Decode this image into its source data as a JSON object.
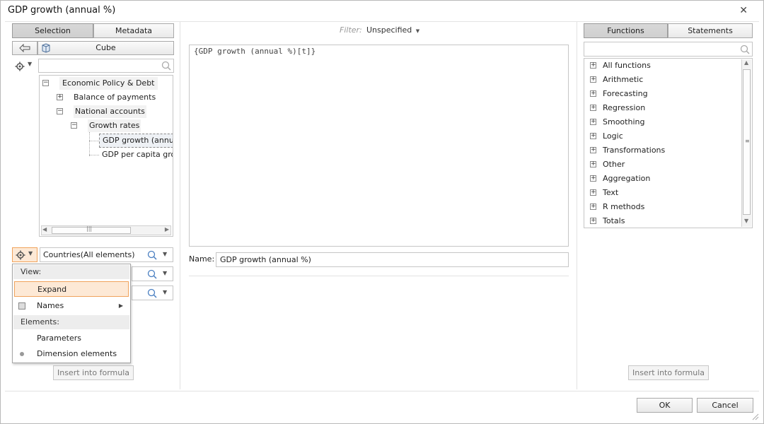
{
  "window": {
    "title": "GDP growth (annual %)"
  },
  "left": {
    "tabs": [
      "Selection",
      "Metadata"
    ],
    "cube_button": "Cube",
    "tree": [
      {
        "label": "Economic Policy & Debt",
        "expander": "−"
      },
      {
        "label": "Balance of payments",
        "expander": "+"
      },
      {
        "label": "National accounts",
        "expander": "−"
      },
      {
        "label": "Growth rates",
        "expander": "−"
      },
      {
        "label": "GDP growth (annual",
        "expander": ""
      },
      {
        "label": "GDP per capita grow",
        "expander": ""
      }
    ],
    "dimension_field": "Countries(All elements)",
    "insert_button": "Insert into formula"
  },
  "menu": {
    "view_header": "View:",
    "expand": "Expand",
    "names": "Names",
    "elements_header": "Elements:",
    "parameters": "Parameters",
    "dimension_elements": "Dimension elements"
  },
  "center": {
    "filter_label": "Filter:",
    "filter_value": "Unspecified",
    "formula": "{GDP growth (annual %)[t]}",
    "name_label": "Name:",
    "name_value": "GDP growth (annual %)"
  },
  "right": {
    "tabs": [
      "Functions",
      "Statements"
    ],
    "functions": [
      "All functions",
      "Arithmetic",
      "Forecasting",
      "Regression",
      "Smoothing",
      "Logic",
      "Transformations",
      "Other",
      "Aggregation",
      "Text",
      "R methods",
      "Totals"
    ],
    "insert_button": "Insert into formula"
  },
  "footer": {
    "ok": "OK",
    "cancel": "Cancel"
  },
  "colors": {
    "accent": "#f0a35c",
    "hover_bg": "#fde9d6"
  }
}
